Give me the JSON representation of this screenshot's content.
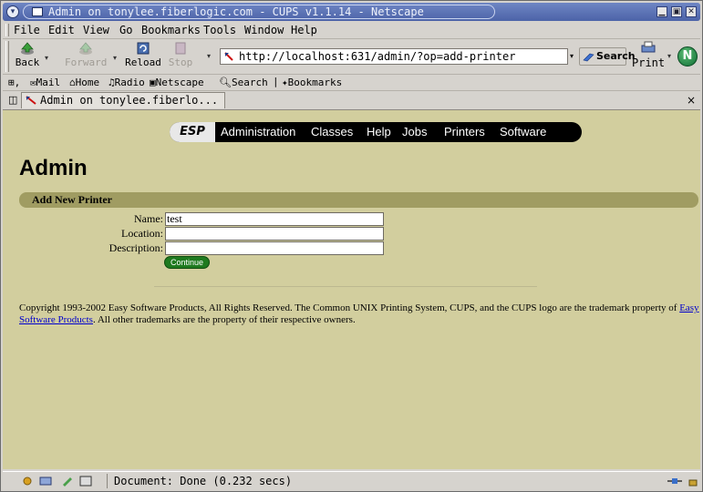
{
  "window": {
    "title": "Admin on tonylee.fiberlogic.com - CUPS v1.1.14 - Netscape"
  },
  "menubar": {
    "items": [
      "File",
      "Edit",
      "View",
      "Go",
      "Bookmarks",
      "Tools",
      "Window",
      "Help"
    ]
  },
  "navbar": {
    "back": "Back",
    "forward": "Forward",
    "reload": "Reload",
    "stop": "Stop",
    "url": "http://localhost:631/admin/?op=add-printer",
    "search": "Search",
    "print": "Print",
    "logo": "N"
  },
  "personal_toolbar": {
    "mail": "Mail",
    "home": "Home",
    "radio": "Radio",
    "netscape": "Netscape",
    "search": "Search",
    "bookmarks": "Bookmarks"
  },
  "tab": {
    "title": "Admin on tonylee.fiberlo...",
    "close": "×"
  },
  "cups_nav": {
    "esp": "ESP",
    "links": [
      "Administration",
      "Classes",
      "Help",
      "Jobs",
      "Printers",
      "Software"
    ]
  },
  "page": {
    "heading": "Admin",
    "section": "Add New Printer",
    "form": {
      "name_label": "Name:",
      "name_value": "test",
      "location_label": "Location:",
      "location_value": "",
      "description_label": "Description:",
      "description_value": "",
      "submit": "Continue"
    },
    "copyright_prefix": "Copyright 1993-2002 Easy Software Products, All Rights Reserved. The Common UNIX Printing System, CUPS, and the CUPS logo are the trademark property of ",
    "copyright_link": "Easy Software Products",
    "copyright_suffix": ". All other trademarks are the property of their respective owners."
  },
  "status": {
    "text": "Document: Done (0.232 secs)"
  },
  "colors": {
    "titlebar": "#5a70b4",
    "content_bg": "#d2ce9e",
    "section_bar": "#a09c62",
    "continue": "#1f7a1f",
    "chrome": "#d6d3ce"
  }
}
